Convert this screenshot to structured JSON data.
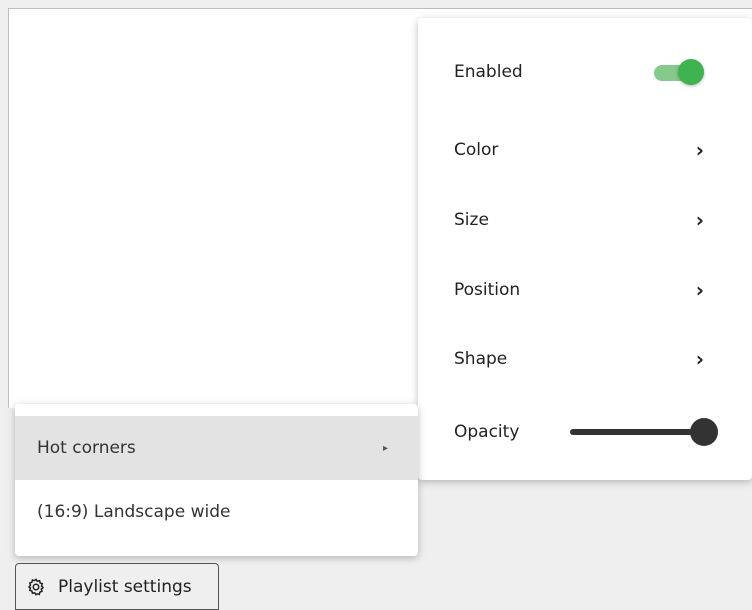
{
  "submenu": {
    "enabled_label": "Enabled",
    "enabled": true,
    "items": [
      {
        "label": "Color"
      },
      {
        "label": "Size"
      },
      {
        "label": "Position"
      },
      {
        "label": "Shape"
      }
    ],
    "opacity_label": "Opacity",
    "opacity_value": 1.0,
    "chevron": "›"
  },
  "menu": {
    "items": [
      {
        "label": "Hot corners"
      },
      {
        "label": "(16:9) Landscape wide"
      }
    ],
    "caret": "▸"
  },
  "footer": {
    "playlist_settings_label": "Playlist settings"
  },
  "colors": {
    "toggle_on": "#3fb34f",
    "toggle_track": "#86c98c",
    "slider": "#333333",
    "active_item": "#e3e3e3"
  }
}
